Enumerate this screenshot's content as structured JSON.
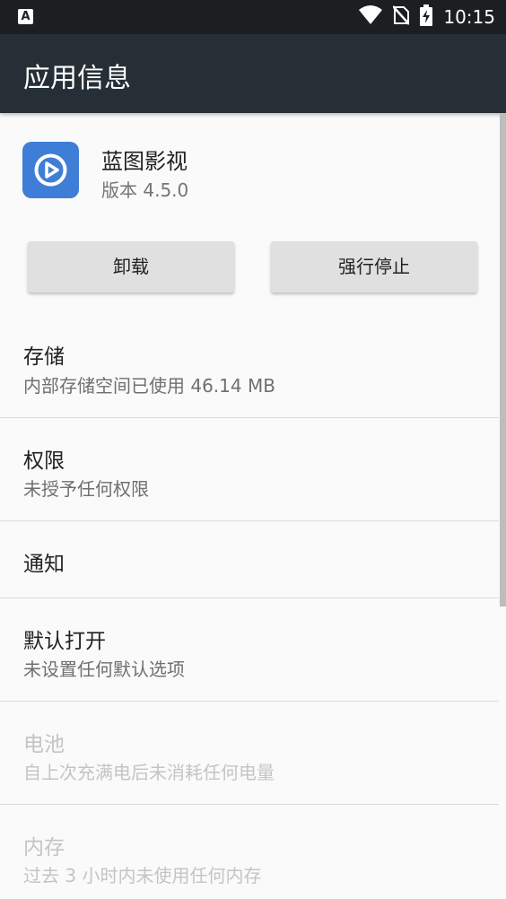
{
  "status_bar": {
    "left_icon_letter": "A",
    "time": "10:15",
    "icons": [
      "wifi-icon",
      "no-sim-icon",
      "battery-charging-icon"
    ]
  },
  "app_bar": {
    "title": "应用信息"
  },
  "app": {
    "name": "蓝图影视",
    "version": "版本 4.5.0",
    "icon": "play-icon",
    "icon_color": "#3f7ed6"
  },
  "buttons": {
    "uninstall": "卸载",
    "force_stop": "强行停止"
  },
  "items": [
    {
      "title": "存储",
      "subtitle": "内部存储空间已使用 46.14 MB",
      "enabled": true
    },
    {
      "title": "权限",
      "subtitle": "未授予任何权限",
      "enabled": true
    },
    {
      "title": "通知",
      "subtitle": "",
      "enabled": true
    },
    {
      "title": "默认打开",
      "subtitle": "未设置任何默认选项",
      "enabled": true
    },
    {
      "title": "电池",
      "subtitle": "自上次充满电后未消耗任何电量",
      "enabled": false
    },
    {
      "title": "内存",
      "subtitle": "过去 3 小时内未使用任何内存",
      "enabled": false
    }
  ]
}
